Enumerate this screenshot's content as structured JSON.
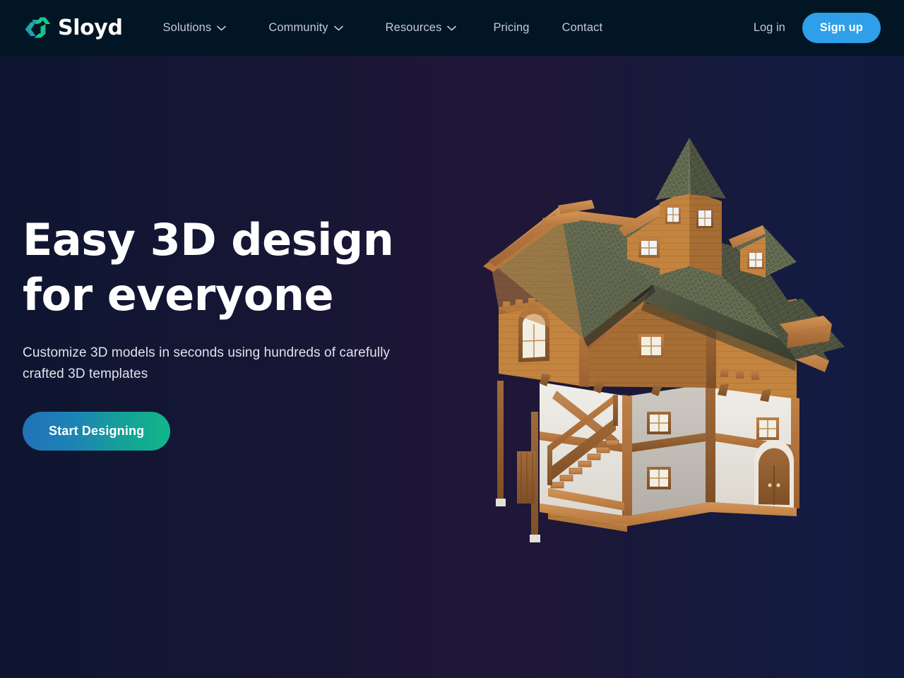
{
  "brand": {
    "name": "Sloyd",
    "logo_icon": "sloyd-rotation-arrows-logo",
    "logo_gradient_from": "#2d7fc4",
    "logo_gradient_to": "#18c98b"
  },
  "header": {
    "background": "#021525",
    "nav": [
      {
        "label": "Solutions",
        "has_dropdown": true,
        "icon": "chevron-down-icon"
      },
      {
        "label": "Community",
        "has_dropdown": true,
        "icon": "chevron-down-icon"
      },
      {
        "label": "Resources",
        "has_dropdown": true,
        "icon": "chevron-down-icon"
      },
      {
        "label": "Pricing",
        "has_dropdown": false
      },
      {
        "label": "Contact",
        "has_dropdown": false
      }
    ],
    "login_label": "Log in",
    "signup_label": "Sign up",
    "signup_color": "#2e9fe8"
  },
  "hero": {
    "title": "Easy 3D design for everyone",
    "subtitle": "Customize 3D models in seconds using hundreds of carefully crafted 3D templates",
    "cta_label": "Start Designing",
    "cta_gradient_from": "#2272b8",
    "cta_gradient_to": "#10b78a",
    "background_gradient_from": "#0e1530",
    "background_gradient_mid": "#201638",
    "background_gradient_to": "#101a3c",
    "illustration": "medieval-timber-house-3d-model"
  }
}
